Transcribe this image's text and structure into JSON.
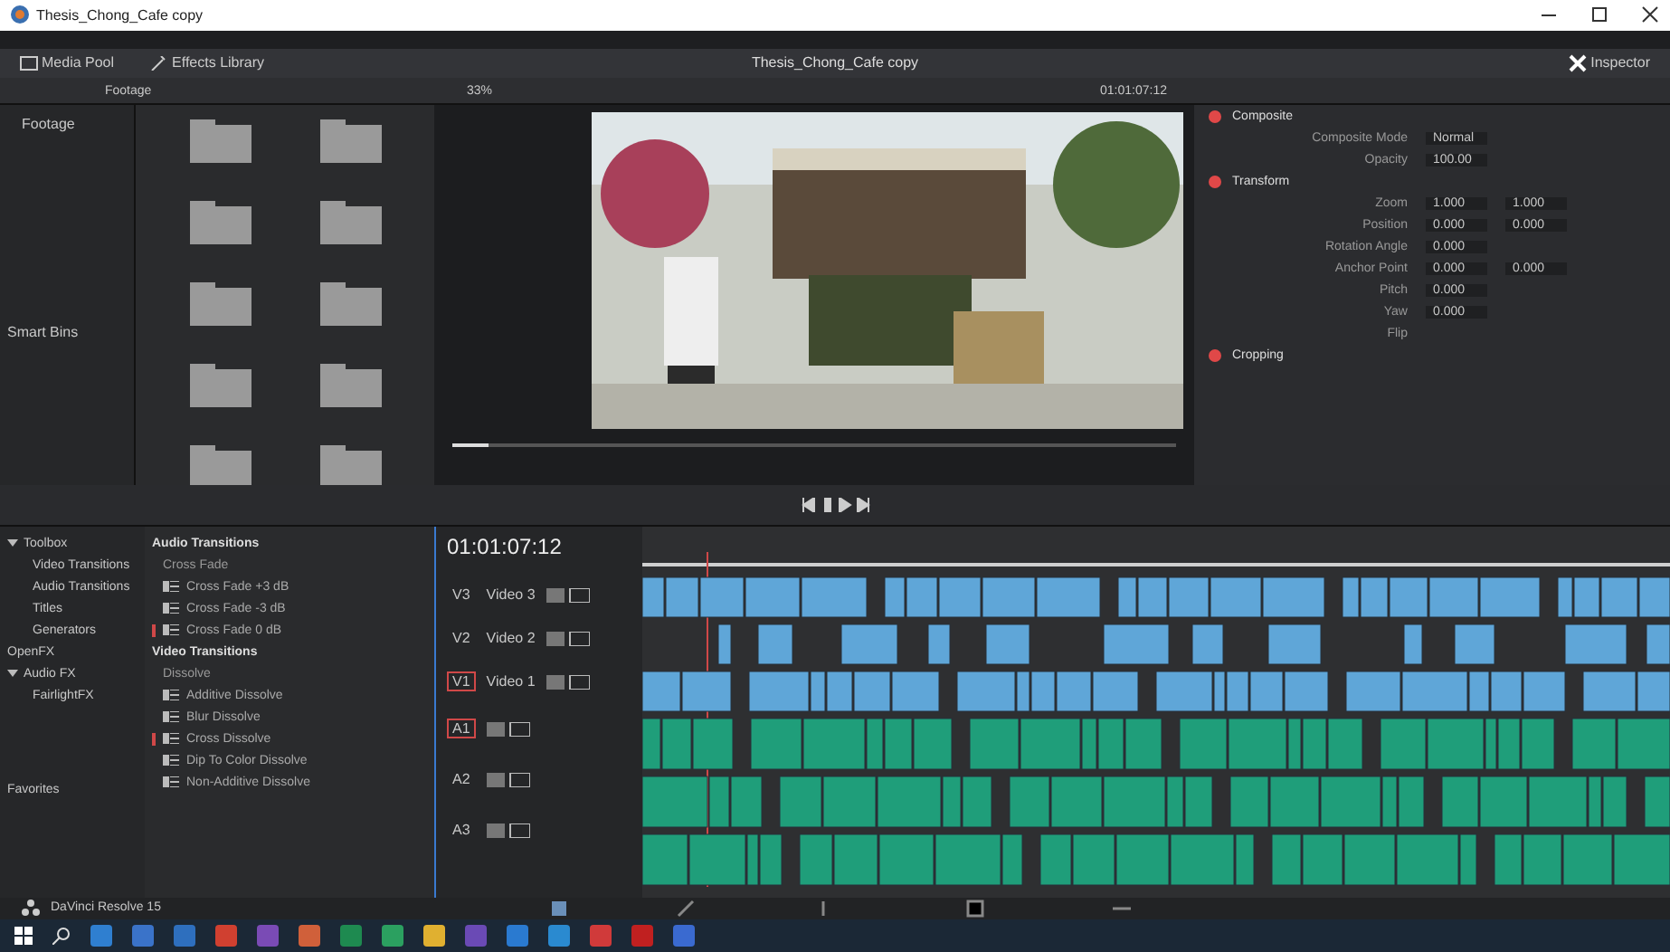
{
  "window": {
    "title": "Thesis_Chong_Cafe copy"
  },
  "toolbar": {
    "buttons": [
      {
        "label": "Media Pool"
      },
      {
        "label": "Effects Library"
      }
    ],
    "project_title": "Thesis_Chong_Cafe copy",
    "inspector_button": "Inspector"
  },
  "subbar": {
    "bin": "Footage",
    "zoom": "33%",
    "timecode": "01:01:07:12"
  },
  "bins": {
    "items": [
      {
        "label": "Footage"
      }
    ],
    "smart_bins": "Smart Bins"
  },
  "media_pool": {
    "clips": [
      {
        "kind": "folder"
      },
      {
        "kind": "folder"
      },
      {
        "kind": "folder"
      },
      {
        "kind": "folder"
      },
      {
        "kind": "folder"
      },
      {
        "kind": "folder"
      },
      {
        "kind": "folder"
      },
      {
        "kind": "folder"
      },
      {
        "kind": "folder"
      },
      {
        "kind": "folder"
      }
    ]
  },
  "viewer": {
    "kind": "picture",
    "level": 0.05
  },
  "inspector": {
    "sections": [
      {
        "title": "Composite",
        "params": [
          {
            "label": "Composite Mode",
            "values": [
              "Normal"
            ]
          },
          {
            "label": "Opacity",
            "values": [
              "100.00"
            ]
          }
        ]
      },
      {
        "title": "Transform",
        "params": [
          {
            "label": "Zoom",
            "values": [
              "1.000",
              "1.000"
            ]
          },
          {
            "label": "Position",
            "values": [
              "0.000",
              "0.000"
            ]
          },
          {
            "label": "Rotation Angle",
            "values": [
              "0.000"
            ]
          },
          {
            "label": "Anchor Point",
            "values": [
              "0.000",
              "0.000"
            ]
          },
          {
            "label": "Pitch",
            "values": [
              "0.000"
            ]
          },
          {
            "label": "Yaw",
            "values": [
              "0.000"
            ]
          },
          {
            "label": "Flip"
          }
        ]
      },
      {
        "title": "Cropping"
      }
    ]
  },
  "effects_sidebar": {
    "items": [
      {
        "label": "Toolbox",
        "expanded": true,
        "children": [
          {
            "label": "Video Transitions"
          },
          {
            "label": "Audio Transitions"
          },
          {
            "label": "Titles"
          },
          {
            "label": "Generators"
          }
        ]
      },
      {
        "label": "OpenFX"
      },
      {
        "label": "Audio FX",
        "expanded": true,
        "children": [
          {
            "label": "FairlightFX"
          }
        ]
      }
    ],
    "favorites": "Favorites"
  },
  "effects_list": {
    "groups": [
      {
        "title": "Audio Transitions",
        "subgroups": [
          {
            "title": "Cross Fade",
            "items": [
              {
                "label": "Cross Fade +3 dB",
                "marked": false
              },
              {
                "label": "Cross Fade -3 dB",
                "marked": false
              },
              {
                "label": "Cross Fade 0 dB",
                "marked": true
              }
            ]
          }
        ]
      },
      {
        "title": "Video Transitions",
        "subgroups": [
          {
            "title": "Dissolve",
            "items": [
              {
                "label": "Additive Dissolve",
                "marked": false
              },
              {
                "label": "Blur Dissolve",
                "marked": false
              },
              {
                "label": "Cross Dissolve",
                "marked": true
              },
              {
                "label": "Dip To Color Dissolve",
                "marked": false
              },
              {
                "label": "Non-Additive Dissolve",
                "marked": false
              }
            ]
          }
        ]
      }
    ]
  },
  "timeline": {
    "timecode": "01:01:07:12",
    "tracks": [
      {
        "kind": "video",
        "id": "V3",
        "name": "Video 3",
        "selected": false
      },
      {
        "kind": "video",
        "id": "V2",
        "name": "Video 2",
        "selected": false
      },
      {
        "kind": "video",
        "id": "V1",
        "name": "Video 1",
        "selected": true
      },
      {
        "kind": "audio",
        "id": "A1",
        "selected": true
      },
      {
        "kind": "audio",
        "id": "A2",
        "selected": false
      },
      {
        "kind": "audio",
        "id": "A3",
        "selected": false
      }
    ]
  },
  "status_bar": {
    "app": "DaVinci Resolve 15"
  }
}
